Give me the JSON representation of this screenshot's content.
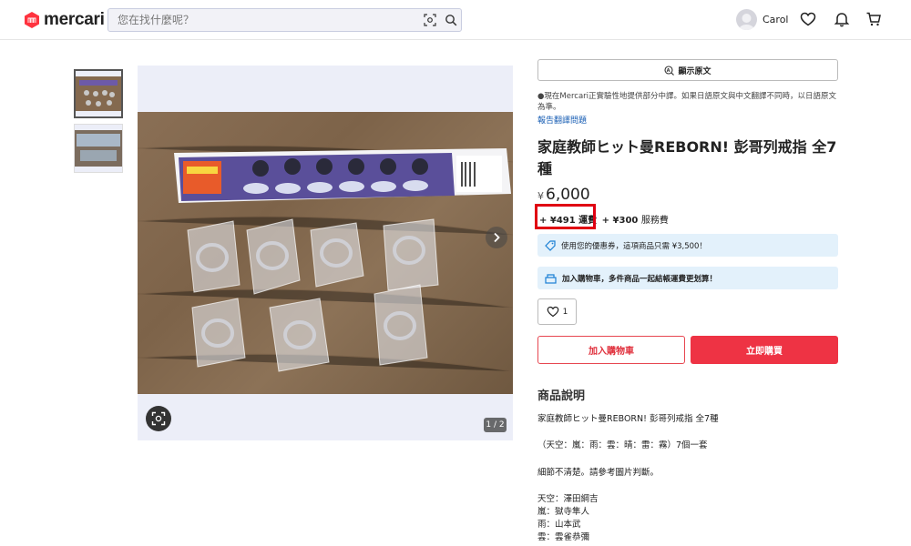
{
  "header": {
    "logo_text": "mercari",
    "search_placeholder": "您在找什麼呢？",
    "user_name": "Carol",
    "brand_color": "#ff333f"
  },
  "gallery": {
    "counter": "1 / 2",
    "thumbnails": [
      "thumbnail-1",
      "thumbnail-2"
    ]
  },
  "product": {
    "show_original_label": "顯示原文",
    "translation_note": "●現在Mercari正實驗性地提供部分中譯。如果日語原文與中文翻譯不同時，以日語原文為準。",
    "report_link": "報告翻譯問題",
    "title": "家庭教師ヒット曼REBORN! 彭哥列戒指 全7種",
    "price_symbol": "¥",
    "price_value": "6,000",
    "shipping_fee": "+ ¥491 運費",
    "service_fee_prefix": "+ ¥300",
    "service_fee_label": "服務費",
    "coupon_text": "使用您的優惠券，這項商品只需 ¥3,500！",
    "cart_note": "加入購物車，多件商品一起結帳運費更划算！",
    "like_count": "1",
    "add_to_cart_label": "加入購物車",
    "buy_now_label": "立即購買"
  },
  "description": {
    "heading": "商品說明",
    "lines": [
      "家庭教師ヒット曼REBORN!  彭哥列戒指 全7種",
      "（天空：嵐：雨：雲：晴：雷：霧）7個一套",
      "細節不清楚。請參考圖片判斷。",
      "天空：澤田綱吉",
      "嵐：獄寺隼人",
      "雨：山本武",
      "雲：雲雀恭彌"
    ]
  },
  "colors": {
    "highlight": "#e00012",
    "buy_button": "#ee3344",
    "info_bar": "#e3f1fb",
    "link": "#1a5fb4"
  }
}
